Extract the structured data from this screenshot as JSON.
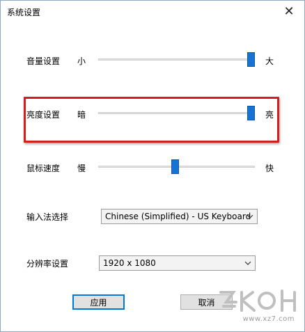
{
  "window": {
    "title": "系统设置",
    "close_glyph": "✕"
  },
  "volume": {
    "label": "音量设置",
    "min_label": "小",
    "max_label": "大",
    "level": 1.0
  },
  "brightness": {
    "label": "亮度设置",
    "min_label": "暗",
    "max_label": "亮",
    "level": 1.0
  },
  "mouse_speed": {
    "label": "鼠标速度",
    "min_label": "慢",
    "max_label": "快",
    "level": 0.5
  },
  "input_method": {
    "label": "输入法选择",
    "value": "Chinese (Simplified) - US Keyboard"
  },
  "resolution": {
    "label": "分辨率设置",
    "value": "1920 x 1080"
  },
  "buttons": {
    "apply": "应用",
    "cancel": "取消"
  },
  "watermark": {
    "text": "www.xz7.com"
  },
  "colors": {
    "accent": "#1673d4",
    "highlight": "#d11f1f"
  }
}
